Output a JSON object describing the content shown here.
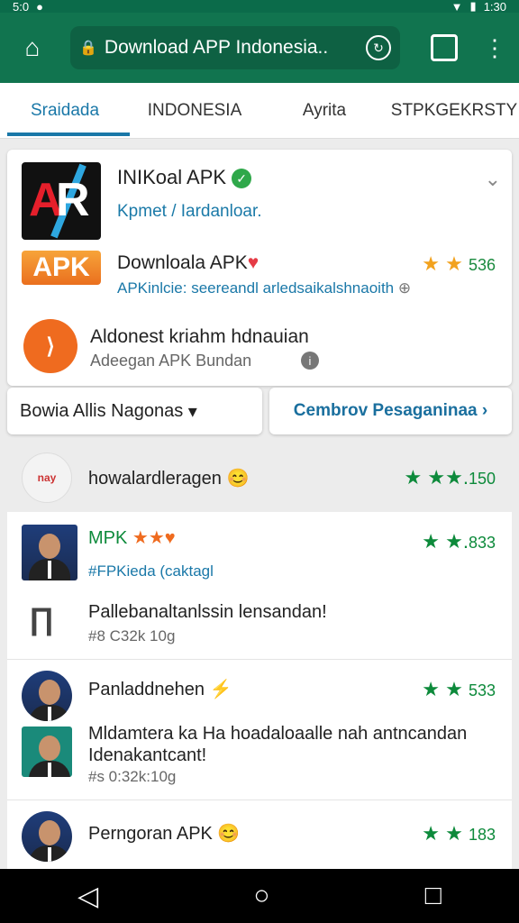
{
  "status": {
    "left": "5:0",
    "time": "1:30"
  },
  "browser": {
    "url": "Download APP Indonesia.."
  },
  "tabs": [
    "Sraidada",
    "INDONESIA",
    "Ayrita",
    "STPKGEKRSTY"
  ],
  "featured": {
    "title": "INIKoal APK",
    "subtitle": "Kpmet / Iardanloar.",
    "apk_badge": "APK",
    "title2": "Downloala APK",
    "rating2": "536",
    "desc2": "APKinlcie: seereandl arledsaikalshnaoith",
    "title3": "Aldonest kriahm hdnauian",
    "sub3": "Adeegan APK Bundan"
  },
  "buttons": {
    "left": "Bowia Allis Nagonas",
    "right": "Cembrov Pesaganinaa"
  },
  "section": {
    "name": "howalardleragen",
    "rating": "150",
    "logo_text": "nay"
  },
  "items": [
    {
      "title": "MPK",
      "meta": "#FPKieda (caktagl",
      "rating": "833",
      "title2": "Pallebanaltanlssin lensandan!",
      "meta2": "#8 C32k 10g"
    },
    {
      "title": "Panladdnehen",
      "rating": "533",
      "title2": "Mldamtera ka Ha hoadaloaalle nah antncandan Idenakantcant!",
      "meta2": "#s 0:32k:10g"
    },
    {
      "title": "Perngoran APK",
      "rating": "183"
    }
  ],
  "icons": {
    "home": "home-icon",
    "lock": "lock-icon",
    "sync": "sync-icon",
    "tabs": "tabs-icon",
    "menu": "more-vert-icon",
    "back": "back-icon",
    "home_nav": "home-nav-icon",
    "recents": "recents-icon"
  },
  "colors": {
    "appbar": "#11744f",
    "accent": "#1a78a8",
    "rating_green": "#0d8a3b",
    "apk_orange": "#ef6b1f"
  }
}
